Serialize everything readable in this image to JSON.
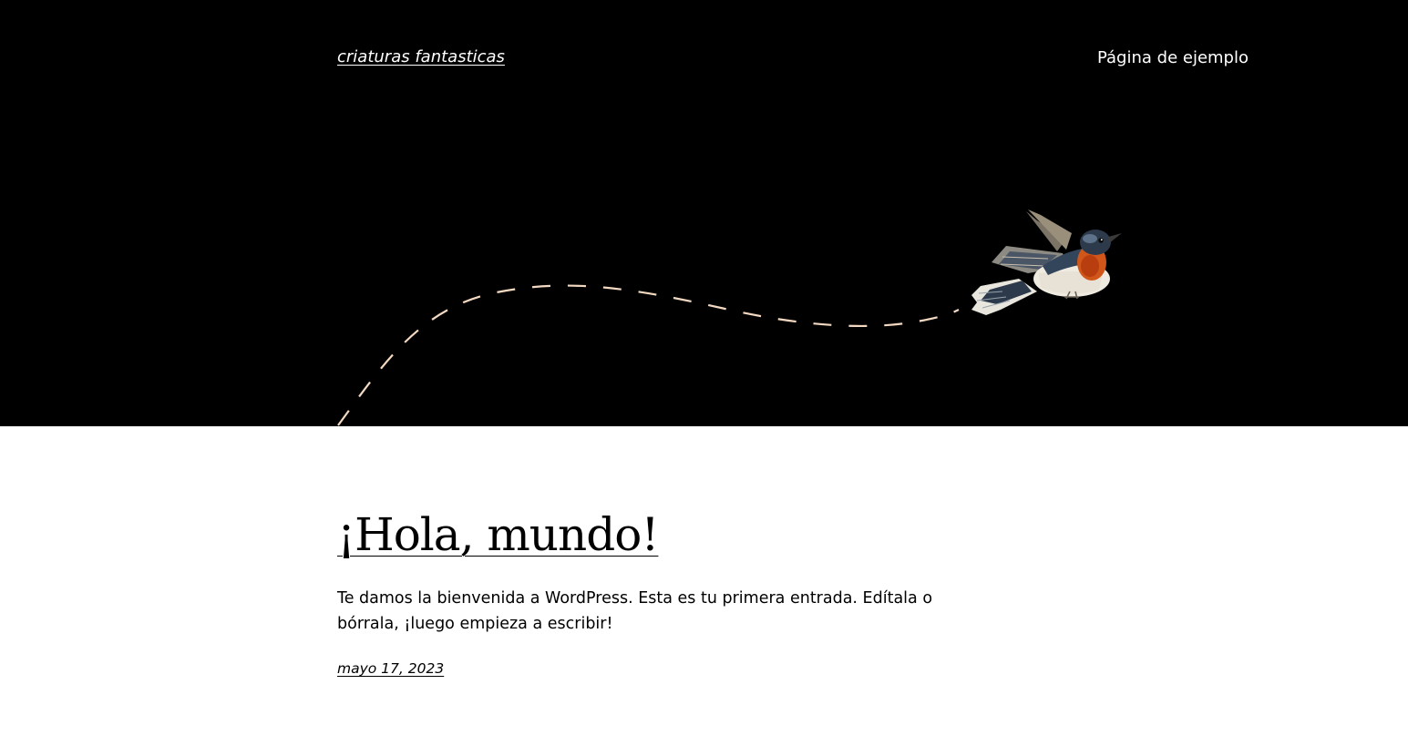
{
  "header": {
    "site_title": "criaturas fantasticas",
    "nav": [
      {
        "label": "Página de ejemplo"
      }
    ]
  },
  "hero": {
    "illustration": "bird-flight-path-illustration",
    "background_color": "#000000",
    "path_color": "#f3d9c2"
  },
  "post": {
    "title": "¡Hola, mundo!",
    "excerpt": "Te damos la bienvenida a WordPress. Esta es tu primera entrada. Edítala o bórrala, ¡luego empieza a escribir!",
    "date": "mayo 17, 2023"
  }
}
